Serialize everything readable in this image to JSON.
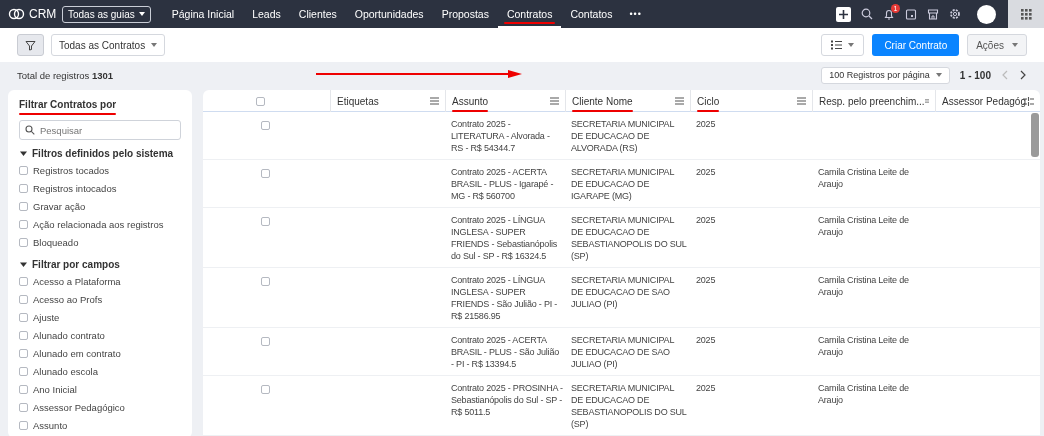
{
  "app": {
    "name": "CRM",
    "modules_menu": "Todas as guias",
    "notification_count": "1"
  },
  "nav": [
    {
      "label": "Página Inicial",
      "selected": false,
      "underlined": false
    },
    {
      "label": "Leads",
      "selected": false,
      "underlined": false
    },
    {
      "label": "Clientes",
      "selected": false,
      "underlined": false
    },
    {
      "label": "Oportunidades",
      "selected": false,
      "underlined": false
    },
    {
      "label": "Propostas",
      "selected": false,
      "underlined": false
    },
    {
      "label": "Contratos",
      "selected": true,
      "underlined": true
    },
    {
      "label": "Contatos",
      "selected": false,
      "underlined": false
    }
  ],
  "nav_more": "•••",
  "toolbar": {
    "view": "Todas as Contratos",
    "create": "Criar Contrato",
    "actions": "Ações"
  },
  "summary": "Total de registros **1301**",
  "annotation_arrow": true,
  "pagination": {
    "per_page": "100 Registros por página",
    "range": "1 - 100"
  },
  "sidebar": {
    "title": "Filtrar Contratos por",
    "title_underlined": true,
    "search_placeholder": "Pesquisar",
    "groups": [
      {
        "title": "Filtros definidos pelo sistema",
        "expanded": true,
        "items": [
          {
            "label": "Registros tocados",
            "checked": false
          },
          {
            "label": "Registros intocados",
            "checked": false
          },
          {
            "label": "Gravar ação",
            "checked": false
          },
          {
            "label": "Ação relacionada aos registros",
            "checked": false
          },
          {
            "label": "Bloqueado",
            "checked": false
          }
        ]
      },
      {
        "title": "Filtrar por campos",
        "expanded": true,
        "items": [
          {
            "label": "Acesso a Plataforma",
            "checked": false
          },
          {
            "label": "Acesso ao Profs",
            "checked": false
          },
          {
            "label": "Ajuste",
            "checked": false
          },
          {
            "label": "Alunado contrato",
            "checked": false
          },
          {
            "label": "Alunado em contrato",
            "checked": false
          },
          {
            "label": "Alunado escola",
            "checked": false
          },
          {
            "label": "Ano Inicial",
            "checked": false
          },
          {
            "label": "Assessor Pedagógico",
            "checked": false
          },
          {
            "label": "Assunto",
            "checked": false
          }
        ]
      }
    ]
  },
  "table": {
    "all_selected": false,
    "columns": [
      {
        "label": "Etiquetas",
        "underlined": false
      },
      {
        "label": "Assunto",
        "underlined": true
      },
      {
        "label": "Cliente Nome",
        "underlined": true
      },
      {
        "label": "Ciclo",
        "underlined": true
      },
      {
        "label": "Resp. pelo preenchim...",
        "underlined": false
      },
      {
        "label": "Assessor Pedagóg",
        "underlined": false
      }
    ],
    "rows": [
      {
        "selected": false,
        "subject": "Contrato 2025 - LITERATURA - Alvorada - RS - R$ 54344.7",
        "client": "SECRETARIA MUNICIPAL DE EDUCACAO DE ALVORADA (RS)",
        "cycle": "2025"
      },
      {
        "selected": false,
        "subject": "Contrato 2025 - ACERTA BRASIL - PLUS - Igarapé - MG - R$ 560700",
        "client": "SECRETARIA MUNICIPAL DE EDUCACAO DE IGARAPE (MG)",
        "cycle": "2025",
        "responsible": "Camila Cristina Leite de Araujo"
      },
      {
        "selected": false,
        "subject": "Contrato 2025 - LÍNGUA INGLESA - SUPER FRIENDS - Sebastianópolis do Sul - SP - R$ 16324.5",
        "client": "SECRETARIA MUNICIPAL DE EDUCACAO DE SEBASTIANOPOLIS DO SUL (SP)",
        "cycle": "2025",
        "responsible": "Camila Cristina Leite de Araujo"
      },
      {
        "selected": false,
        "subject": "Contrato 2025 - LÍNGUA INGLESA - SUPER FRIENDS - São Julião - PI - R$ 21586.95",
        "client": "SECRETARIA MUNICIPAL DE EDUCACAO DE SAO JULIAO (PI)",
        "cycle": "2025",
        "responsible": "Camila Cristina Leite de Araujo"
      },
      {
        "selected": false,
        "subject": "Contrato 2025 - ACERTA BRASIL - PLUS - São Julião - PI - R$ 13394.5",
        "client": "SECRETARIA MUNICIPAL DE EDUCACAO DE SAO JULIAO (PI)",
        "cycle": "2025",
        "responsible": "Camila Cristina Leite de Araujo"
      },
      {
        "selected": false,
        "subject": "Contrato 2025 - PROSINHA - Sebastianópolis do Sul - SP - R$ 5011.5",
        "client": "SECRETARIA MUNICIPAL DE EDUCACAO DE SEBASTIANOPOLIS DO SUL (SP)",
        "cycle": "2025",
        "responsible": "Camila Cristina Leite de Araujo"
      }
    ]
  }
}
